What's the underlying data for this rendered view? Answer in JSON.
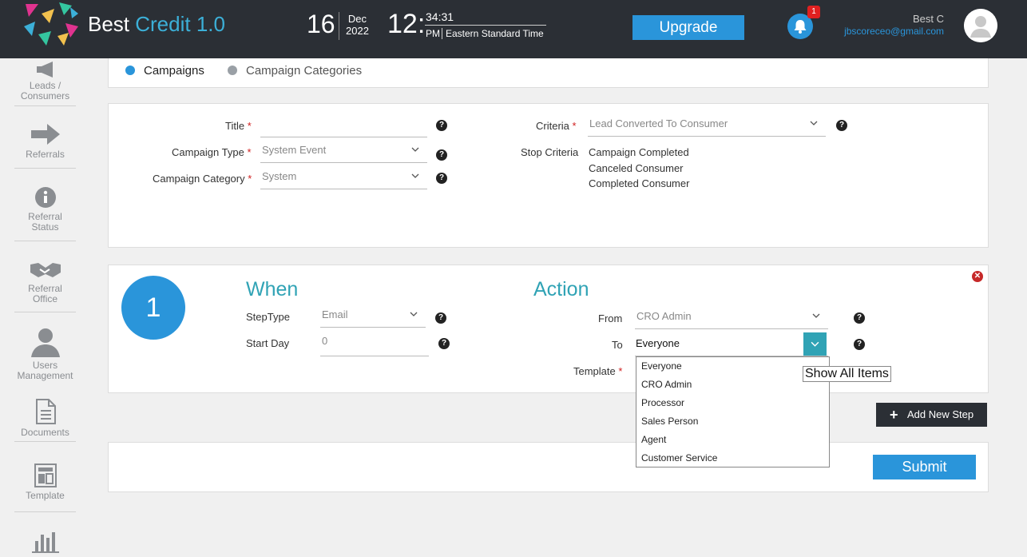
{
  "header": {
    "brand_main": "Best ",
    "brand_accent": "Credit 1.0",
    "date_day": "16",
    "date_month": "Dec",
    "date_year": "2022",
    "time_hour": "12:",
    "time_minsec": "34:31",
    "time_ampm": "PM",
    "time_zone": "Eastern Standard Time",
    "upgrade_label": "Upgrade",
    "notification_count": "1",
    "user_name": "Best C",
    "user_email": "jbscoreceo@gmail.com"
  },
  "sidebar": {
    "items": [
      {
        "label": "Leads / Consumers",
        "icon": "megaphone-icon"
      },
      {
        "label": "Referrals",
        "icon": "arrow-right-icon"
      },
      {
        "label": "Referral Status",
        "icon": "info-icon"
      },
      {
        "label": "Referral Office",
        "icon": "handshake-icon"
      },
      {
        "label": "Users Management",
        "icon": "user-icon"
      },
      {
        "label": "Documents",
        "icon": "document-icon"
      },
      {
        "label": "Template",
        "icon": "template-icon"
      },
      {
        "label": "",
        "icon": "bar-chart-icon"
      }
    ]
  },
  "tabs": [
    {
      "label": "Campaigns",
      "active": true
    },
    {
      "label": "Campaign Categories",
      "active": false
    }
  ],
  "form": {
    "title_label": "Title",
    "title_value": "",
    "campaign_type_label": "Campaign Type",
    "campaign_type_value": "System Event",
    "campaign_category_label": "Campaign Category",
    "campaign_category_value": "System",
    "criteria_label": "Criteria",
    "criteria_value": "Lead Converted To Consumer",
    "stop_criteria_label": "Stop Criteria",
    "stop_criteria_values": [
      "Campaign Completed",
      "Canceled Consumer",
      "Completed Consumer"
    ],
    "required_mark": "*",
    "help_glyph": "?"
  },
  "step": {
    "number": "1",
    "when_heading": "When",
    "action_heading": "Action",
    "step_type_label": "StepType",
    "step_type_value": "Email",
    "start_day_label": "Start Day",
    "start_day_placeholder": "0",
    "from_label": "From",
    "from_value": "CRO Admin",
    "to_label": "To",
    "to_value": "Everyone",
    "template_label": "Template",
    "close_glyph": "✕"
  },
  "to_dropdown": {
    "options": [
      "Everyone",
      "CRO Admin",
      "Processor",
      "Sales Person",
      "Agent",
      "Customer Service"
    ],
    "tooltip": "Show All Items"
  },
  "actions": {
    "add_step_label": "Add New Step",
    "add_step_glyph": "+",
    "submit_label": "Submit"
  },
  "colors": {
    "accent_blue": "#2a95da",
    "teal": "#30a3b5",
    "topbar": "#2b2f35",
    "required_red": "#d02020"
  }
}
